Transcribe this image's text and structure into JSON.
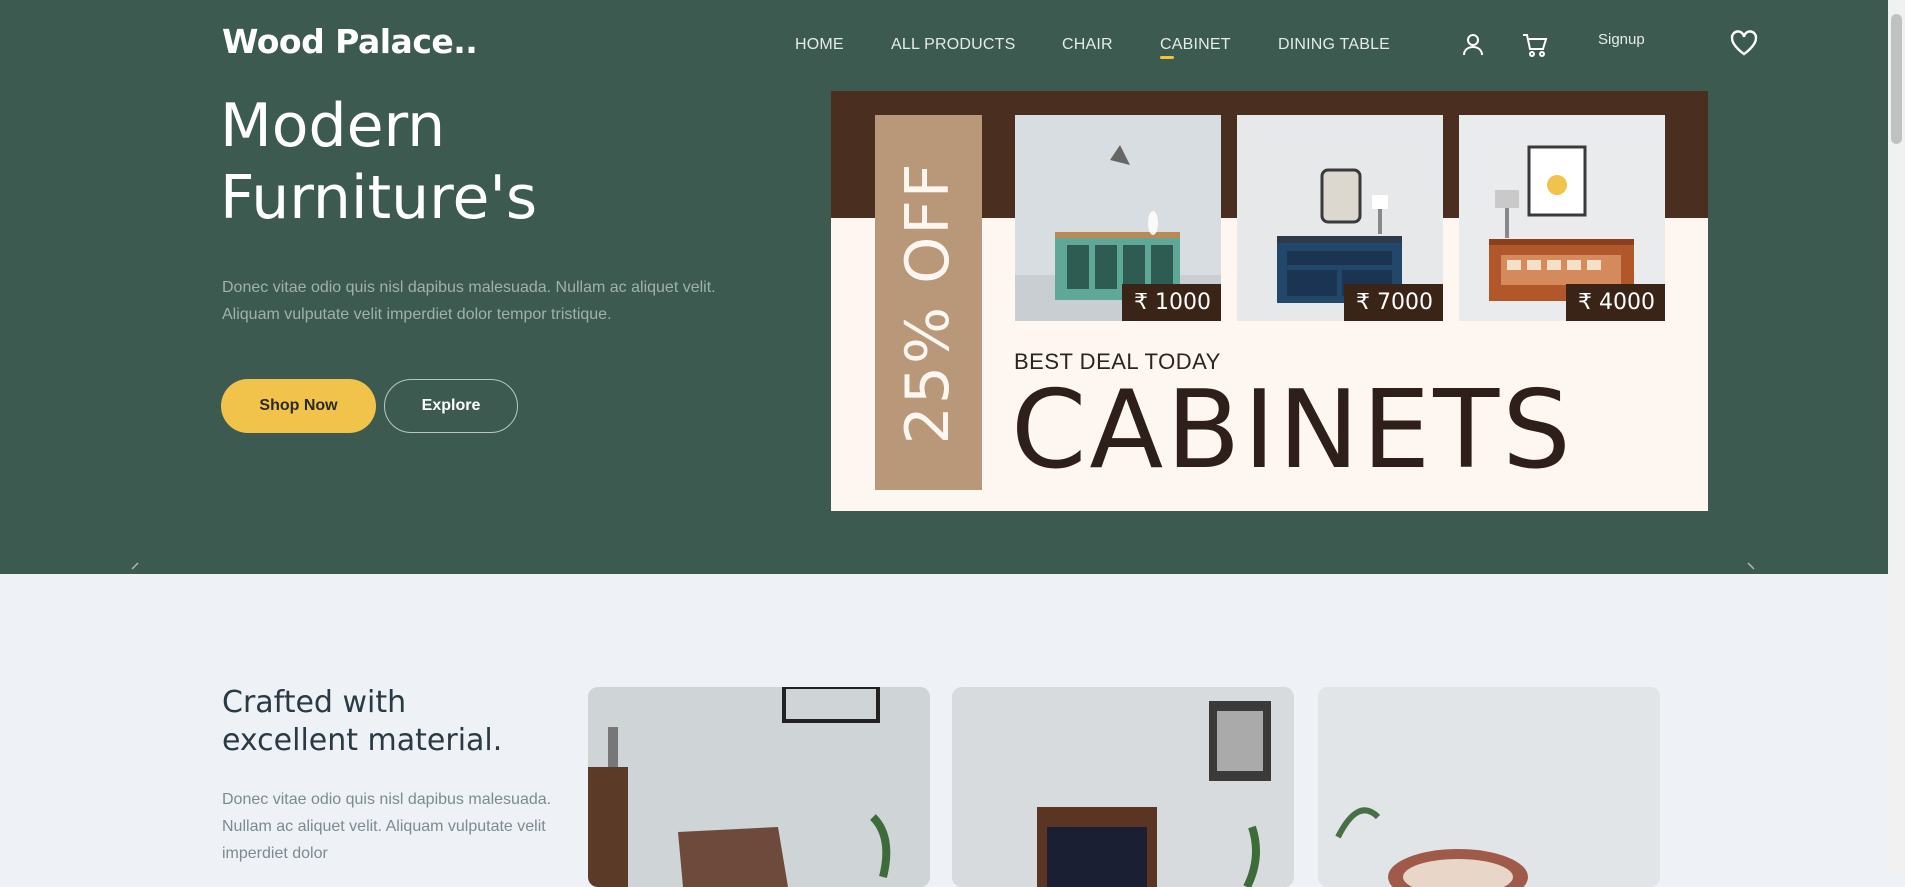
{
  "brand": {
    "logo": "Wood Palace.."
  },
  "nav": {
    "items": [
      "HOME",
      "ALL PRODUCTS",
      "CHAIR",
      "CABINET",
      "DINING TABLE"
    ],
    "active_index": 3,
    "signup": "Signup"
  },
  "hero": {
    "title_line1": "Modern",
    "title_line2": "Furniture's",
    "description": "Donec vitae odio quis nisl dapibus malesuada. Nullam ac aliquet velit. Aliquam vulputate velit imperdiet dolor tempor tristique.",
    "primary_button": "Shop Now",
    "secondary_button": "Explore",
    "accent_color": "#f1c34b",
    "bg_color": "#3d5a50"
  },
  "banner": {
    "discount": "25% OFF",
    "subtitle": "BEST DEAL TODAY",
    "title": "CABINETS",
    "products": [
      {
        "price": "₹ 1000",
        "color": "#5fa898"
      },
      {
        "price": "₹ 7000",
        "color": "#23476a"
      },
      {
        "price": "₹ 4000",
        "color": "#b2572a"
      }
    ]
  },
  "section": {
    "title_line1": "Crafted with",
    "title_line2": "excellent material.",
    "description": "Donec vitae odio quis nisl dapibus malesuada. Nullam ac aliquet velit. Aliquam vulputate velit imperdiet dolor"
  }
}
